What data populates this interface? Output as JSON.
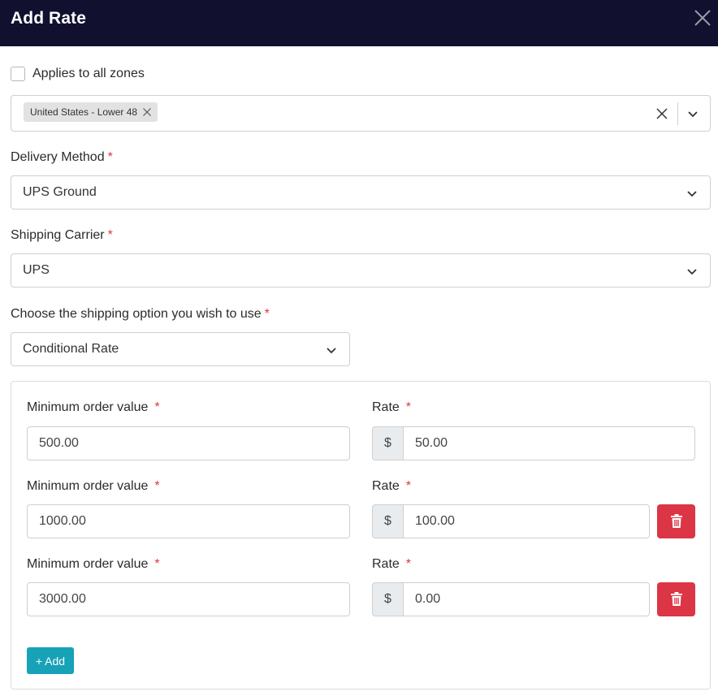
{
  "header": {
    "title": "Add Rate"
  },
  "applies_all": {
    "label": "Applies to all zones",
    "checked": false
  },
  "zones": {
    "chips": [
      "United States - Lower 48"
    ]
  },
  "delivery": {
    "label": "Delivery Method",
    "required": "*",
    "value": "UPS Ground"
  },
  "carrier": {
    "label": "Shipping Carrier",
    "required": "*",
    "value": "UPS"
  },
  "shipping_option": {
    "label": "Choose the shipping option you wish to use",
    "required": "*",
    "value": "Conditional Rate"
  },
  "rates": {
    "currency": "$",
    "min_label": "Minimum order value",
    "rate_label": "Rate",
    "required": "*",
    "rows": [
      {
        "min": "500.00",
        "rate": "50.00"
      },
      {
        "min": "1000.00",
        "rate": "100.00"
      },
      {
        "min": "3000.00",
        "rate": "0.00"
      }
    ],
    "add_label": "+ Add"
  },
  "icons": {
    "close": "close-icon",
    "clear": "clear-icon",
    "caret": "chevron-down-icon",
    "delete": "trash-icon"
  },
  "colors": {
    "header_bg": "#11102f",
    "required": "#dc3545",
    "delete_bg": "#dc3545",
    "add_bg": "#17a2b8",
    "chip_bg": "#e2e2e2"
  }
}
